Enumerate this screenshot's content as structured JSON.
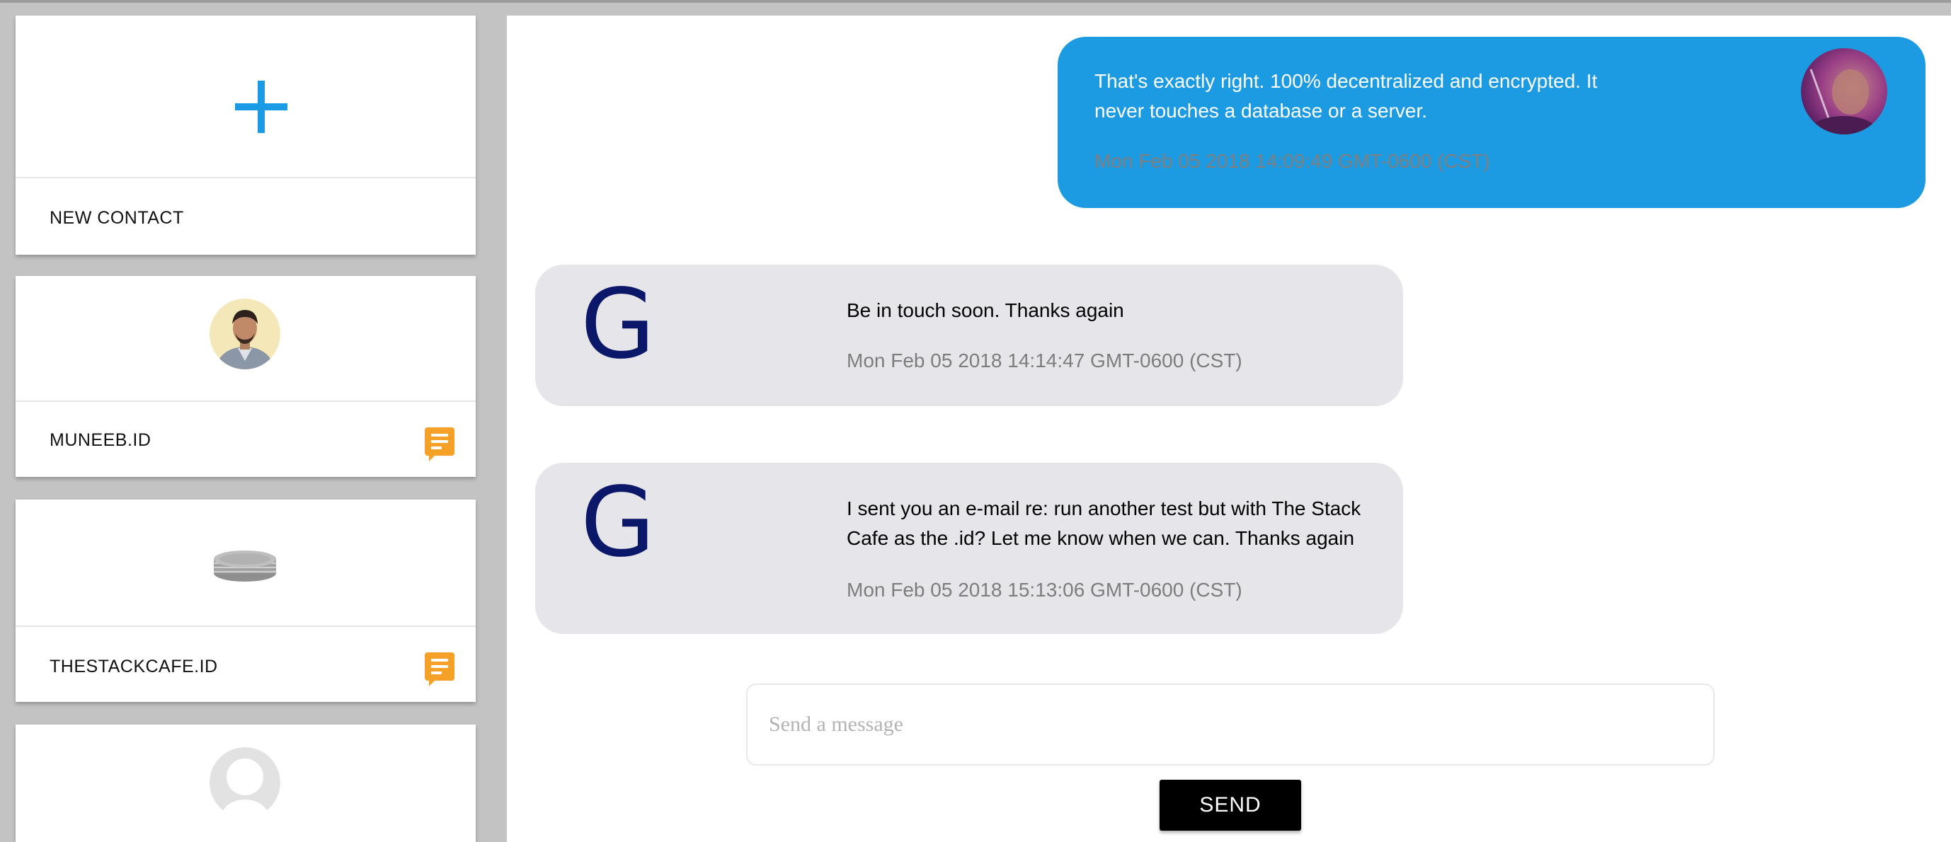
{
  "contacts": {
    "new_contact_label": "NEW CONTACT",
    "items": [
      {
        "name": "MUNEEB.ID",
        "avatar": "person-photo-avatar",
        "icon": "chat-bubble-icon"
      },
      {
        "name": "THESTACKCAFE.ID",
        "avatar": "stack-logo-avatar",
        "icon": "chat-bubble-icon"
      },
      {
        "name": "",
        "avatar": "default-user-avatar"
      }
    ]
  },
  "conversation": {
    "messages": [
      {
        "direction": "outgoing",
        "text": "That's exactly right. 100% decentralized and encrypted. It never touches a database or a server.",
        "timestamp": "Mon Feb 05 2018 14:09:49 GMT-0600 (CST)"
      },
      {
        "direction": "incoming",
        "sender_initial": "G",
        "text": "Be in touch soon. Thanks again",
        "timestamp": "Mon Feb 05 2018 14:14:47 GMT-0600 (CST)"
      },
      {
        "direction": "incoming",
        "sender_initial": "G",
        "text": "I sent you an e-mail re: run another test but with The Stack Cafe as the .id? Let me know when we can. Thanks again",
        "timestamp": "Mon Feb 05 2018 15:13:06 GMT-0600 (CST)"
      }
    ]
  },
  "composer": {
    "placeholder": "Send a message",
    "value": "",
    "send_label": "SEND"
  },
  "colors": {
    "accent": "#1d9be2",
    "badge": "#f5a027",
    "incoming_bubble": "#e6e6ea",
    "initial_letter": "#0b1769"
  }
}
